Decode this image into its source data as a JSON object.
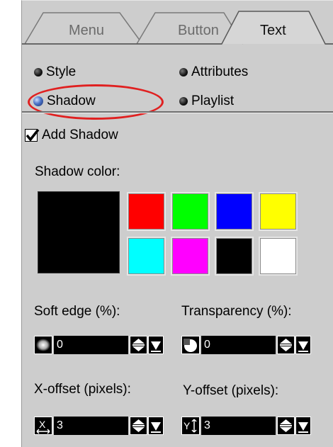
{
  "tabs": [
    {
      "label": "Menu",
      "active": false
    },
    {
      "label": "Button",
      "active": false
    },
    {
      "label": "Text",
      "active": true
    }
  ],
  "options": [
    {
      "label": "Style",
      "selected": false
    },
    {
      "label": "Attributes",
      "selected": false
    },
    {
      "label": "Shadow",
      "selected": true
    },
    {
      "label": "Playlist",
      "selected": false
    }
  ],
  "add_shadow": {
    "label": "Add Shadow",
    "checked": true
  },
  "shadow_color": {
    "label": "Shadow color:",
    "current": "#000000",
    "palette": [
      "#ff0000",
      "#00ff00",
      "#0000ff",
      "#ffff00",
      "#00ffff",
      "#ff00ff",
      "#000000",
      "#ffffff"
    ]
  },
  "soft_edge": {
    "label": "Soft edge (%):",
    "value": "0"
  },
  "transparency": {
    "label": "Transparency (%):",
    "value": "0"
  },
  "x_offset": {
    "label": "X-offset (pixels):",
    "value": "3"
  },
  "y_offset": {
    "label": "Y-offset (pixels):",
    "value": "3"
  },
  "colors": {
    "panel": "#cdcdcd",
    "highlight": "#e02020",
    "active_radio": "#4b73c8"
  },
  "icons": {
    "soft_edge": "soft-edge-icon",
    "transparency": "transparency-icon",
    "x_offset": "x-offset-icon",
    "y_offset": "y-offset-icon",
    "spin": "spin-updown-icon",
    "dropdown": "dropdown-arrow-icon"
  }
}
